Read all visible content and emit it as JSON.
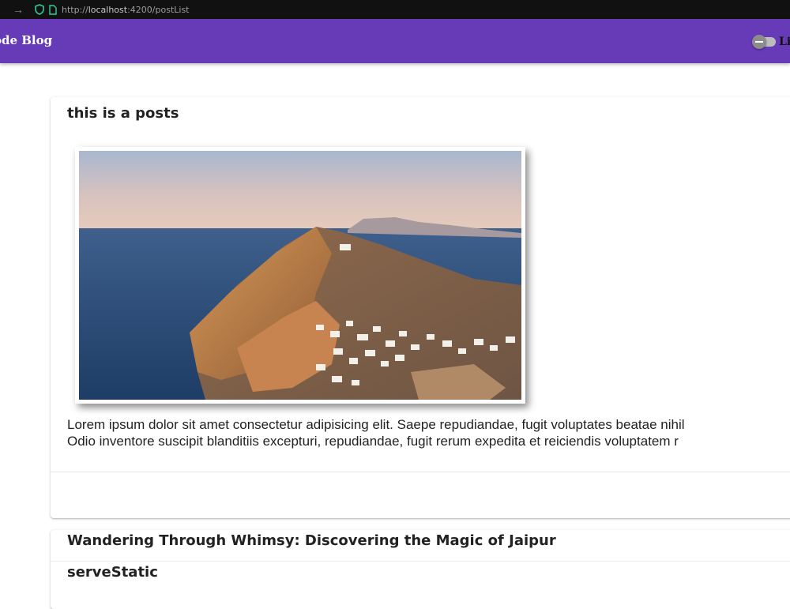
{
  "browser": {
    "back_arrow": "→",
    "url_prefix": "http://",
    "url_host": "localhost",
    "url_rest": ":4200/postList"
  },
  "header": {
    "brand": "ode Blog",
    "theme_toggle_label": "Li"
  },
  "posts": [
    {
      "title": "this is a posts",
      "image_alt": "Aerial view of a cliffside village above the sea",
      "body_line_1": "Lorem ipsum dolor sit amet consectetur adipisicing elit. Saepe repudiandae, fugit voluptates beatae nihil",
      "body_line_2": "Odio inventore suscipit blanditiis excepturi, repudiandae, fugit rerum expedita et reiciendis voluptatem r"
    },
    {
      "title": "Wandering Through Whimsy: Discovering the Magic of Jaipur",
      "subtitle": "serveStatic"
    }
  ],
  "colors": {
    "header_bg": "#673ab7",
    "browser_bg": "#111111"
  }
}
